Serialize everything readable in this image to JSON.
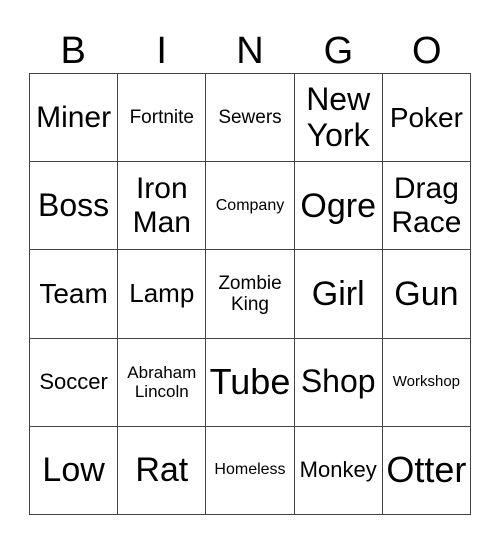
{
  "header": {
    "letters": [
      "B",
      "I",
      "N",
      "G",
      "O"
    ]
  },
  "board": {
    "rows": [
      [
        "Miner",
        "Fortnite",
        "Sewers",
        "New York",
        "Poker"
      ],
      [
        "Boss",
        "Iron Man",
        "Company",
        "Ogre",
        "Drag Race"
      ],
      [
        "Team",
        "Lamp",
        "Zombie King",
        "Girl",
        "Gun"
      ],
      [
        "Soccer",
        "Abraham Lincoln",
        "Tube",
        "Shop",
        "Workshop"
      ],
      [
        "Low",
        "Rat",
        "Homeless",
        "Monkey",
        "Otter"
      ]
    ]
  }
}
